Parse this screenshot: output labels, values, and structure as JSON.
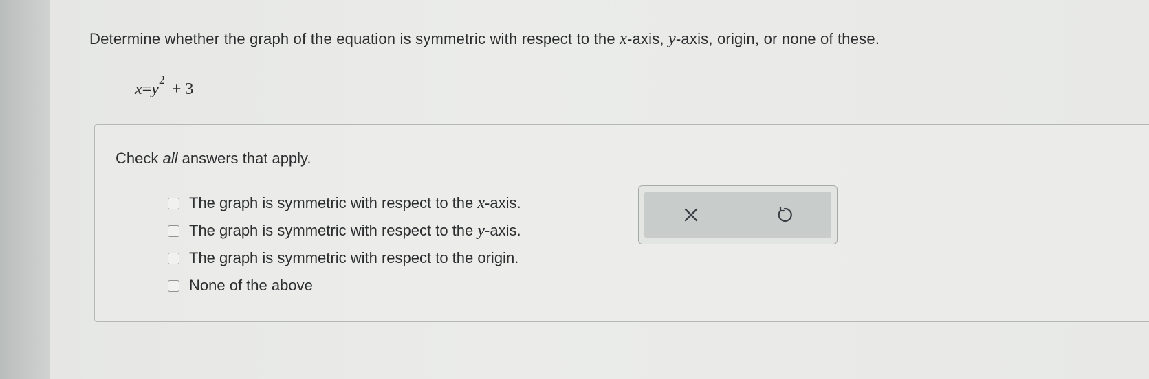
{
  "question": {
    "prefix": "Determine whether the graph of the equation is symmetric with respect to the ",
    "var_x": "x",
    "middle1": "-axis, ",
    "var_y": "y",
    "suffix": "-axis, origin, or none of these."
  },
  "equation": {
    "lhs": "x",
    "equals": "=",
    "base": "y",
    "exponent": "2",
    "rest": "+ 3"
  },
  "instruction": {
    "before": "Check ",
    "emphasis": "all",
    "after": " answers that apply."
  },
  "options": [
    {
      "before": "The graph is symmetric with respect to the ",
      "var": "x",
      "after": "-axis.",
      "checked": false
    },
    {
      "before": "The graph is symmetric with respect to the ",
      "var": "y",
      "after": "-axis.",
      "checked": false
    },
    {
      "before": "The graph is symmetric with respect to the origin.",
      "var": "",
      "after": "",
      "checked": false
    },
    {
      "before": "None of the above",
      "var": "",
      "after": "",
      "checked": false
    }
  ],
  "tools": {
    "clear_icon": "close-icon",
    "undo_icon": "undo-icon"
  },
  "colors": {
    "text": "#2b2d2f",
    "panel_inner": "#c8cccb",
    "icon": "#3a3e44"
  }
}
